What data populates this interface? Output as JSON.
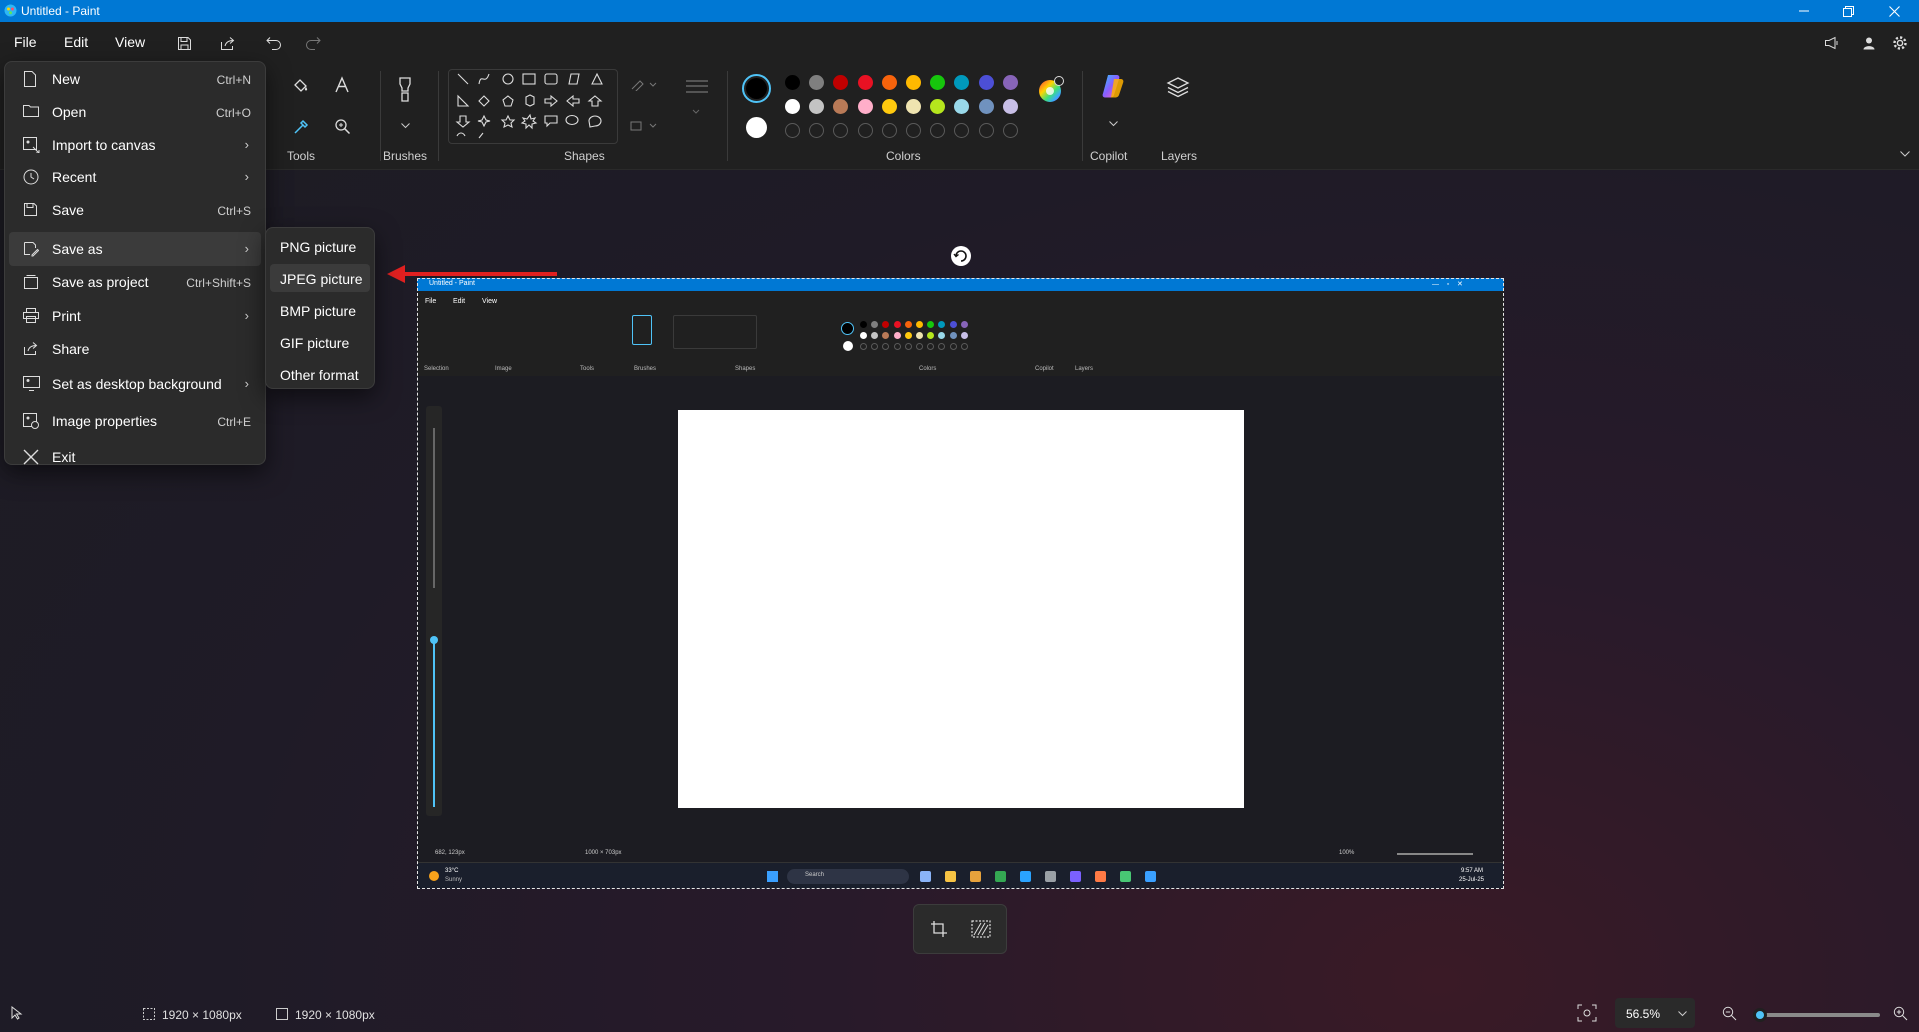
{
  "window": {
    "title": "Untitled - Paint"
  },
  "menubar": {
    "file": "File",
    "edit": "Edit",
    "view": "View"
  },
  "ribbon": {
    "groups": {
      "tools": "Tools",
      "brushes": "Brushes",
      "shapes": "Shapes",
      "colors": "Colors",
      "copilot": "Copilot",
      "layers": "Layers"
    },
    "palette_row1": [
      "#000000",
      "#7f7f7f",
      "#c00000",
      "#e81123",
      "#f7630c",
      "#ffb900",
      "#16c60c",
      "#0099bc",
      "#4c4fd6",
      "#8764b8"
    ],
    "palette_row2": [
      "#ffffff",
      "#c3c3c3",
      "#b97a57",
      "#ffaec9",
      "#ffc90e",
      "#efe4b0",
      "#b5e61d",
      "#99d9ea",
      "#7092be",
      "#c8bfe7"
    ],
    "primary_color": "#000000",
    "secondary_color": "#ffffff"
  },
  "file_menu": {
    "items": [
      {
        "label": "New",
        "shortcut": "Ctrl+N"
      },
      {
        "label": "Open",
        "shortcut": "Ctrl+O"
      },
      {
        "label": "Import to canvas",
        "submenu": true
      },
      {
        "label": "Recent",
        "submenu": true
      },
      {
        "label": "Save",
        "shortcut": "Ctrl+S"
      },
      {
        "label": "Save as",
        "submenu": true,
        "active": true
      },
      {
        "label": "Save as project",
        "shortcut": "Ctrl+Shift+S"
      },
      {
        "label": "Print",
        "submenu": true
      },
      {
        "label": "Share"
      },
      {
        "label": "Set as desktop background",
        "submenu": true
      },
      {
        "label": "Image properties",
        "shortcut": "Ctrl+E"
      },
      {
        "label": "Exit"
      }
    ]
  },
  "save_as_submenu": {
    "items": [
      "PNG picture",
      "JPEG picture",
      "BMP picture",
      "GIF picture",
      "Other format"
    ],
    "highlighted": "JPEG picture"
  },
  "canvas_image": {
    "title": "Untitled - Paint",
    "menu": [
      "File",
      "Edit",
      "View"
    ],
    "groups": [
      "Selection",
      "Image",
      "Tools",
      "Brushes",
      "Shapes",
      "Colors",
      "Copilot",
      "Layers"
    ],
    "cursor_pos": "682, 123px",
    "canvas_size": "1000 × 703px",
    "zoom": "100%",
    "taskbar": {
      "temp": "33°C",
      "weather": "Sunny",
      "search": "Search",
      "time": "9:57 AM",
      "date": "25-Jul-25"
    }
  },
  "status": {
    "selection_size": "1920 × 1080px",
    "canvas_size": "1920 × 1080px",
    "zoom": "56.5%"
  }
}
